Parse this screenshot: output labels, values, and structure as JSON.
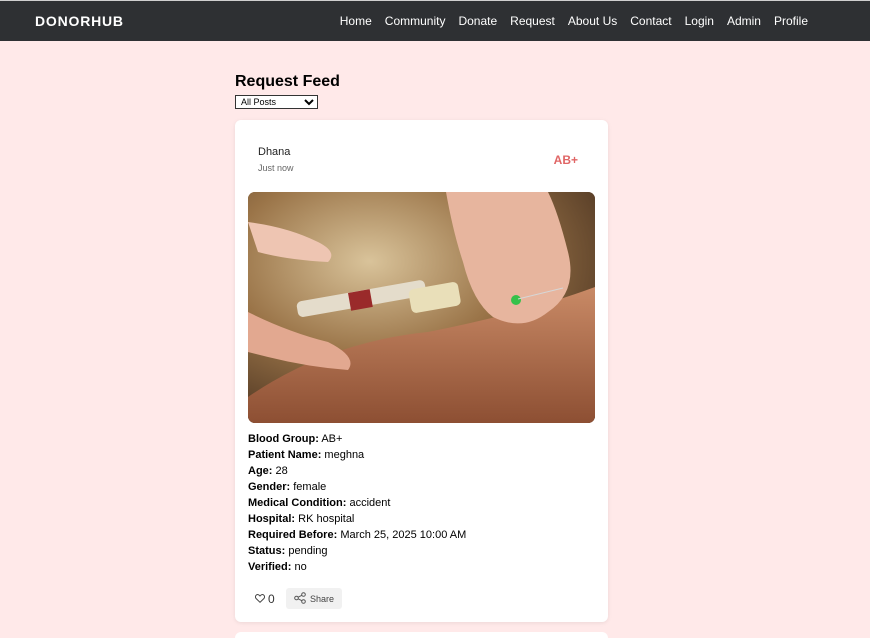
{
  "nav": {
    "brand": "DONORHUB",
    "links": [
      "Home",
      "Community",
      "Donate",
      "Request",
      "About Us",
      "Contact",
      "Login",
      "Admin",
      "Profile"
    ]
  },
  "feed": {
    "title": "Request Feed",
    "filter_selected": "All Posts"
  },
  "post": {
    "author": "Dhana",
    "time": "Just now",
    "blood_badge": "AB+",
    "details": [
      {
        "label": "Blood Group:",
        "value": "AB+"
      },
      {
        "label": "Patient Name:",
        "value": "meghna"
      },
      {
        "label": "Age:",
        "value": "28"
      },
      {
        "label": "Gender:",
        "value": "female"
      },
      {
        "label": "Medical Condition:",
        "value": "accident"
      },
      {
        "label": "Hospital:",
        "value": "RK hospital"
      },
      {
        "label": "Required Before:",
        "value": "March 25, 2025 10:00 AM"
      },
      {
        "label": "Status:",
        "value": "pending"
      },
      {
        "label": "Verified:",
        "value": "no"
      }
    ],
    "like_count": "0",
    "share_label": "Share",
    "like_icon": "heart-icon",
    "share_icon": "share-icon"
  },
  "colors": {
    "page_bg": "#ffe9e9",
    "navbar_bg": "#2e3033",
    "badge": "#e06666"
  }
}
